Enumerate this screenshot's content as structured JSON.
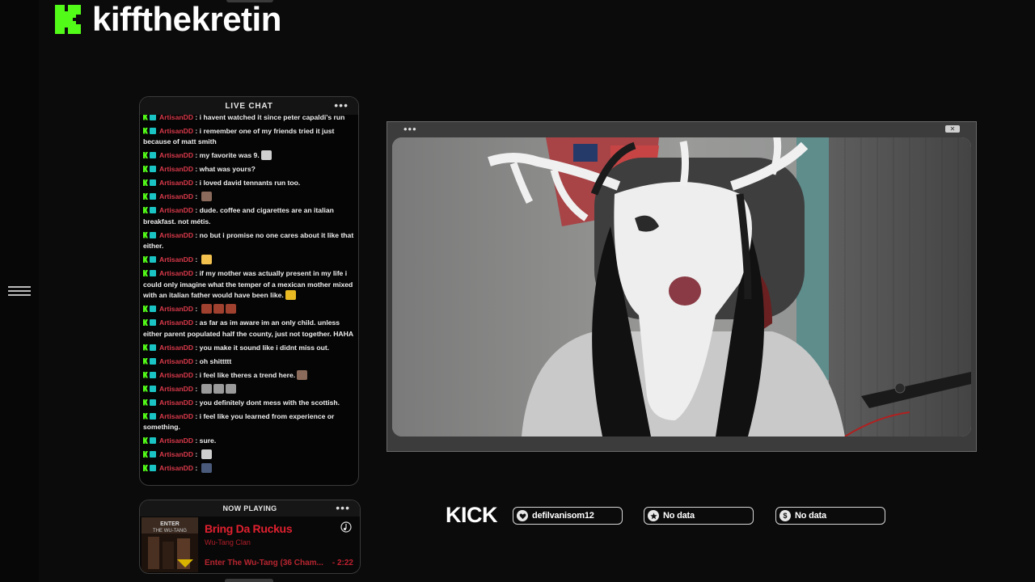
{
  "brand": {
    "name": "kiffthekretin",
    "accent": "#53fc18"
  },
  "chat": {
    "title": "LIVE CHAT",
    "username": "ArtisanDD",
    "messages": [
      {
        "text": "i havent watched it since peter capaldi's run"
      },
      {
        "text": "i remember one of my friends tried it just because of matt smith"
      },
      {
        "text": "my favorite was 9.",
        "emotes": [
          "skull"
        ]
      },
      {
        "text": "what was yours?"
      },
      {
        "text": "i loved david tennants run too."
      },
      {
        "text": "",
        "emotes": [
          "face"
        ]
      },
      {
        "text": "dude. coffee and cigarettes are an italian breakfast. not métis."
      },
      {
        "text": "no but i promise no one cares about it like that either."
      },
      {
        "text": "",
        "emotes": [
          "smile"
        ]
      },
      {
        "text": "if my mother was actually present in my life i could only imagine what the temper of a mexican mother mixed with an italian father would have been like.",
        "emotes": [
          "crown"
        ]
      },
      {
        "text": "",
        "emotes": [
          "face2",
          "face2",
          "face2"
        ]
      },
      {
        "text": "as far as im aware im an only child. unless either parent populated half the county, just not together. HAHA"
      },
      {
        "text": "you make it sound like i didnt miss out."
      },
      {
        "text": "oh shittttt"
      },
      {
        "text": "i feel like theres a trend here.",
        "emotes": [
          "face"
        ]
      },
      {
        "text": "",
        "emotes": [
          "knife",
          "knife",
          "knife"
        ]
      },
      {
        "text": "you definitely dont mess with the scottish."
      },
      {
        "text": "i feel like you learned from experience or something."
      },
      {
        "text": "sure."
      },
      {
        "text": "",
        "emotes": [
          "skull"
        ]
      },
      {
        "text": "",
        "emotes": [
          "hat"
        ]
      }
    ]
  },
  "now_playing": {
    "title": "NOW PLAYING",
    "song": "Bring Da Ruckus",
    "artist": "Wu-Tang Clan",
    "album": "Enter The Wu-Tang (36 Cham...",
    "time": "- 2:22",
    "album_art_text": "ENTER THE WU-TANG"
  },
  "video": {},
  "stats": {
    "platform": "KICK",
    "items": [
      {
        "icon": "heart-icon",
        "label": "defilvanisom12"
      },
      {
        "icon": "star-icon",
        "label": "No data"
      },
      {
        "icon": "dollar-icon",
        "label": "No data"
      }
    ]
  }
}
